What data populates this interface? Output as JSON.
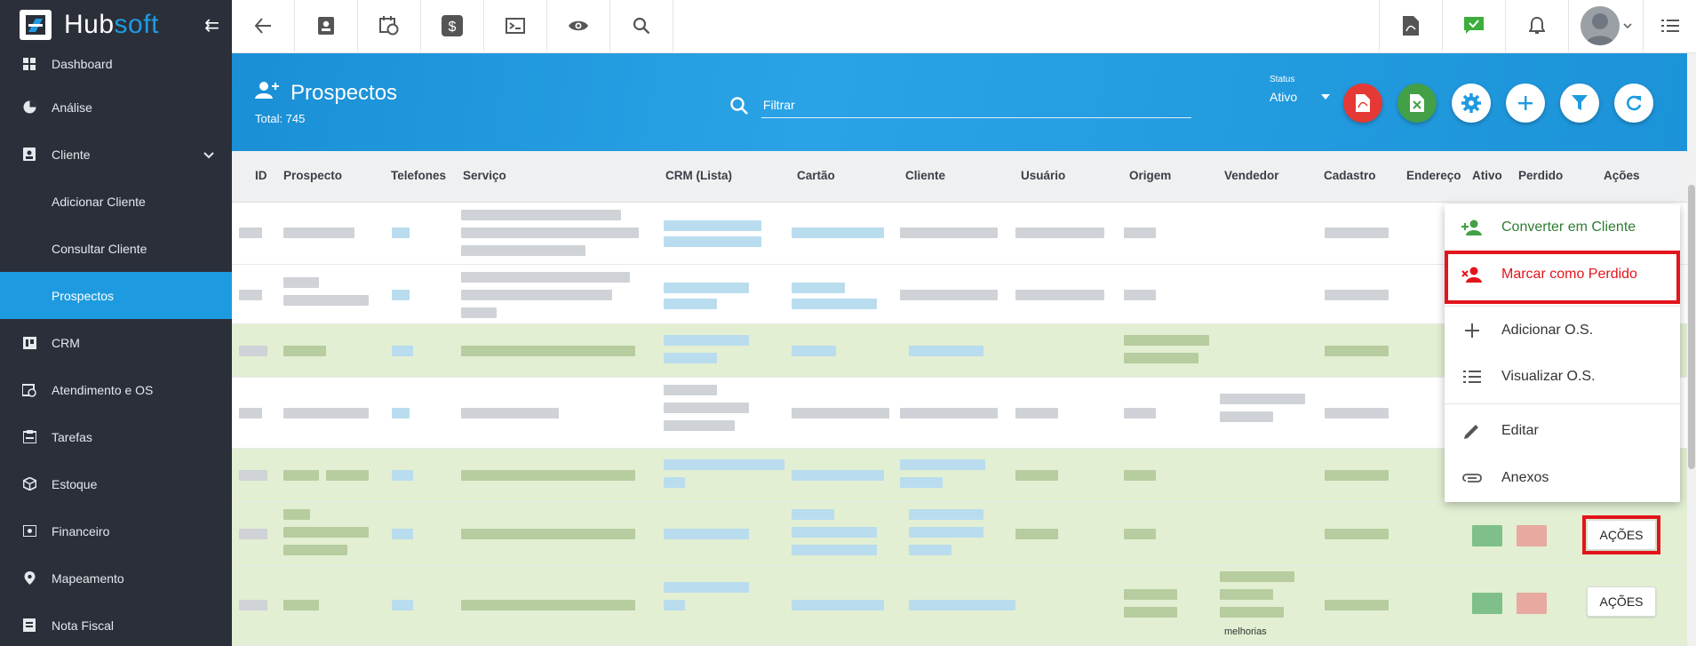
{
  "brand": {
    "name_a": "Hub",
    "name_b": "soft"
  },
  "sidebar": {
    "items": [
      {
        "label": "Dashboard"
      },
      {
        "label": "Análise"
      },
      {
        "label": "Cliente"
      },
      {
        "label": "Adicionar Cliente"
      },
      {
        "label": "Consultar Cliente"
      },
      {
        "label": "Prospectos"
      },
      {
        "label": "CRM"
      },
      {
        "label": "Atendimento e OS"
      },
      {
        "label": "Tarefas"
      },
      {
        "label": "Estoque"
      },
      {
        "label": "Financeiro"
      },
      {
        "label": "Mapeamento"
      },
      {
        "label": "Nota Fiscal"
      }
    ]
  },
  "header": {
    "title": "Prospectos",
    "total": "Total: 745",
    "filter_placeholder": "Filtrar",
    "status_label": "Status",
    "status_value": "Ativo"
  },
  "table": {
    "columns": [
      "ID",
      "Prospecto",
      "Telefones",
      "Serviço",
      "CRM (Lista)",
      "Cartão",
      "Cliente",
      "Usuário",
      "Origem",
      "Vendedor",
      "Cadastro",
      "Endereço",
      "Ativo",
      "Perdido",
      "Ações"
    ],
    "actions_label": "AÇÕES",
    "row_note": "melhorias"
  },
  "menu": {
    "items": [
      {
        "label": "Converter em Cliente",
        "color": "#2e7d32"
      },
      {
        "label": "Marcar como Perdido",
        "color": "#e3141b"
      },
      {
        "label": "Adicionar O.S."
      },
      {
        "label": "Visualizar O.S."
      },
      {
        "label": "Editar"
      },
      {
        "label": "Anexos"
      }
    ]
  },
  "colors": {
    "sidebar_bg": "#2b2f3a",
    "accent": "#1e9be0",
    "highlight": "#e3141b",
    "row_green": "#e2efd2"
  }
}
